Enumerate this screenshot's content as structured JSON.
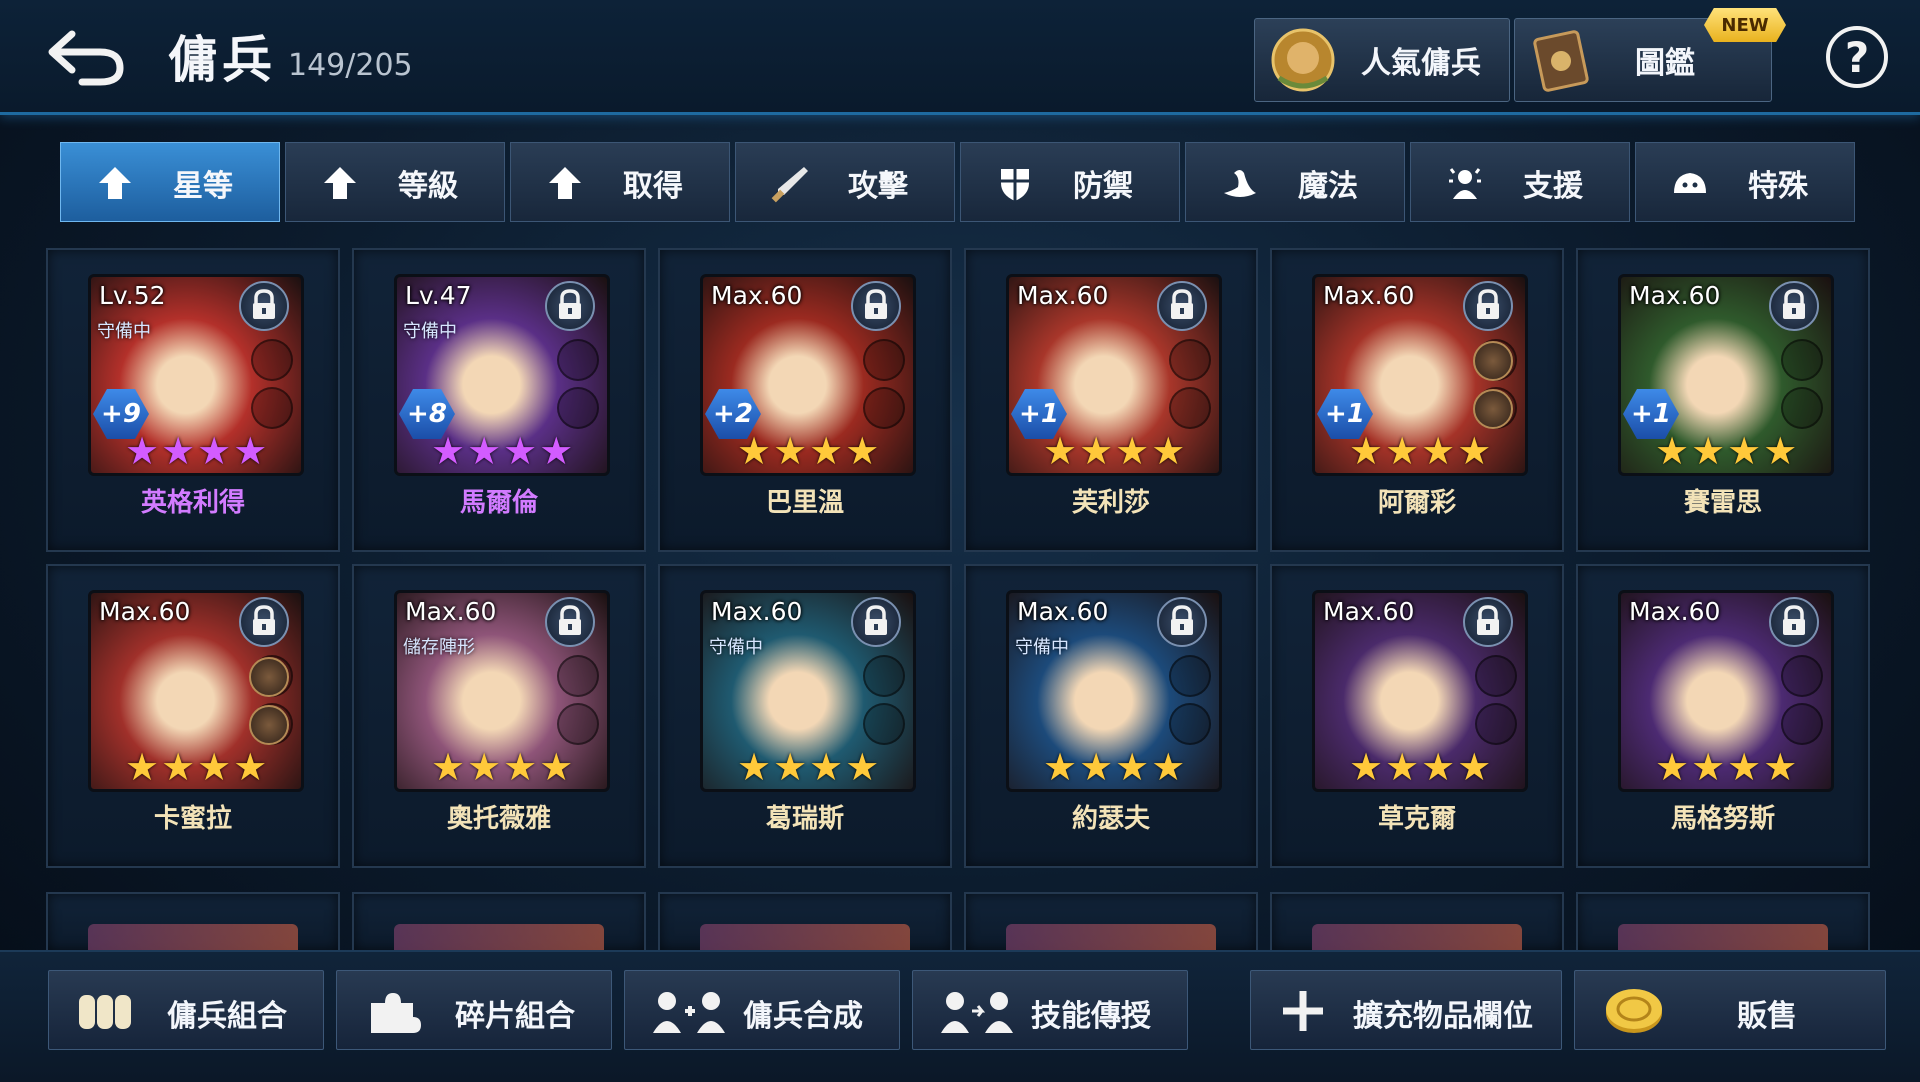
{
  "header": {
    "title": "傭兵",
    "count": "149/205",
    "popular_label": "人氣傭兵",
    "codex_label": "圖鑑",
    "new_badge": "NEW",
    "help_symbol": "?"
  },
  "tabs": [
    {
      "label": "星等",
      "icon": "arrow-up-icon",
      "active": true
    },
    {
      "label": "等級",
      "icon": "arrow-up-icon"
    },
    {
      "label": "取得",
      "icon": "arrow-up-icon"
    },
    {
      "label": "攻擊",
      "icon": "sword-icon"
    },
    {
      "label": "防禦",
      "icon": "shield-icon"
    },
    {
      "label": "魔法",
      "icon": "magic-hat-icon"
    },
    {
      "label": "支援",
      "icon": "support-icon"
    },
    {
      "label": "特殊",
      "icon": "special-icon"
    }
  ],
  "mercenaries": [
    {
      "level": "Lv.52",
      "status": "守備中",
      "plus": "+9",
      "name": "英格利得",
      "stars": 4,
      "star_color": "#d35cff",
      "name_color": "#d27bff",
      "bg": "#b3302a",
      "stars_on": [
        "★",
        "★",
        "★",
        "★"
      ]
    },
    {
      "level": "Lv.47",
      "status": "守備中",
      "plus": "+8",
      "name": "馬爾倫",
      "stars": 4,
      "star_color": "#d35cff",
      "name_color": "#d27bff",
      "bg": "#5a2f86",
      "stars_on": [
        "★",
        "★",
        "★",
        "★"
      ]
    },
    {
      "level": "Max.60",
      "status": "",
      "plus": "+2",
      "name": "巴里溫",
      "stars": 4,
      "star_color": "#ffc93a",
      "name_color": "#f3e3b8",
      "bg": "#9b2a20",
      "stars_on": [
        "★",
        "★",
        "★",
        "★"
      ]
    },
    {
      "level": "Max.60",
      "status": "",
      "plus": "+1",
      "name": "芙利莎",
      "stars": 4,
      "star_color": "#ffc93a",
      "name_color": "#f3e3b8",
      "bg": "#a8362a",
      "stars_on": [
        "★",
        "★",
        "★",
        "★"
      ]
    },
    {
      "level": "Max.60",
      "status": "",
      "plus": "+1",
      "name": "阿爾彩",
      "stars": 4,
      "star_color": "#ffc93a",
      "name_color": "#f3e3b8",
      "bg": "#a53328",
      "stars_on": [
        "★",
        "★",
        "★",
        "★"
      ]
    },
    {
      "level": "Max.60",
      "status": "",
      "plus": "+1",
      "name": "賽雷思",
      "stars": 4,
      "star_color": "#ffc93a",
      "name_color": "#f3e3b8",
      "bg": "#2f5a2c",
      "stars_on": [
        "★",
        "★",
        "★",
        "★"
      ]
    },
    {
      "level": "Max.60",
      "status": "",
      "plus": "",
      "name": "卡蜜拉",
      "stars": 4,
      "star_color": "#ffc93a",
      "name_color": "#f3e3b8",
      "bg": "#a0302a",
      "stars_on": [
        "★",
        "★",
        "★",
        "★"
      ]
    },
    {
      "level": "Max.60",
      "status": "儲存陣形",
      "plus": "",
      "name": "奧托薇雅",
      "stars": 4,
      "star_color": "#ffc93a",
      "name_color": "#f3e3b8",
      "bg": "#8e5478",
      "stars_on": [
        "★",
        "★",
        "★",
        "★"
      ]
    },
    {
      "level": "Max.60",
      "status": "守備中",
      "plus": "",
      "name": "葛瑞斯",
      "stars": 4,
      "star_color": "#ffc93a",
      "name_color": "#f3e3b8",
      "bg": "#1f5a70",
      "stars_on": [
        "★",
        "★",
        "★",
        "★"
      ]
    },
    {
      "level": "Max.60",
      "status": "守備中",
      "plus": "",
      "name": "約瑟夫",
      "stars": 4,
      "star_color": "#ffc93a",
      "name_color": "#f3e3b8",
      "bg": "#1c4a7a",
      "stars_on": [
        "★",
        "★",
        "★",
        "★"
      ]
    },
    {
      "level": "Max.60",
      "status": "",
      "plus": "",
      "name": "草克爾",
      "stars": 4,
      "star_color": "#ffc93a",
      "name_color": "#f3e3b8",
      "bg": "#4a2a6a",
      "stars_on": [
        "★",
        "★",
        "★",
        "★"
      ]
    },
    {
      "level": "Max.60",
      "status": "",
      "plus": "",
      "name": "馬格努斯",
      "stars": 4,
      "star_color": "#ffc93a",
      "name_color": "#f3e3b8",
      "bg": "#4c2a72",
      "stars_on": [
        "★",
        "★",
        "★",
        "★"
      ]
    }
  ],
  "bottom_buttons": [
    {
      "label": "傭兵組合",
      "icon": "team-icon"
    },
    {
      "label": "碎片組合",
      "icon": "puzzle-icon"
    },
    {
      "label": "傭兵合成",
      "icon": "merge-icon"
    },
    {
      "label": "技能傳授",
      "icon": "transfer-icon"
    },
    {
      "label": "擴充物品欄位",
      "icon": "plus-icon"
    },
    {
      "label": "販售",
      "icon": "coin-icon"
    }
  ]
}
